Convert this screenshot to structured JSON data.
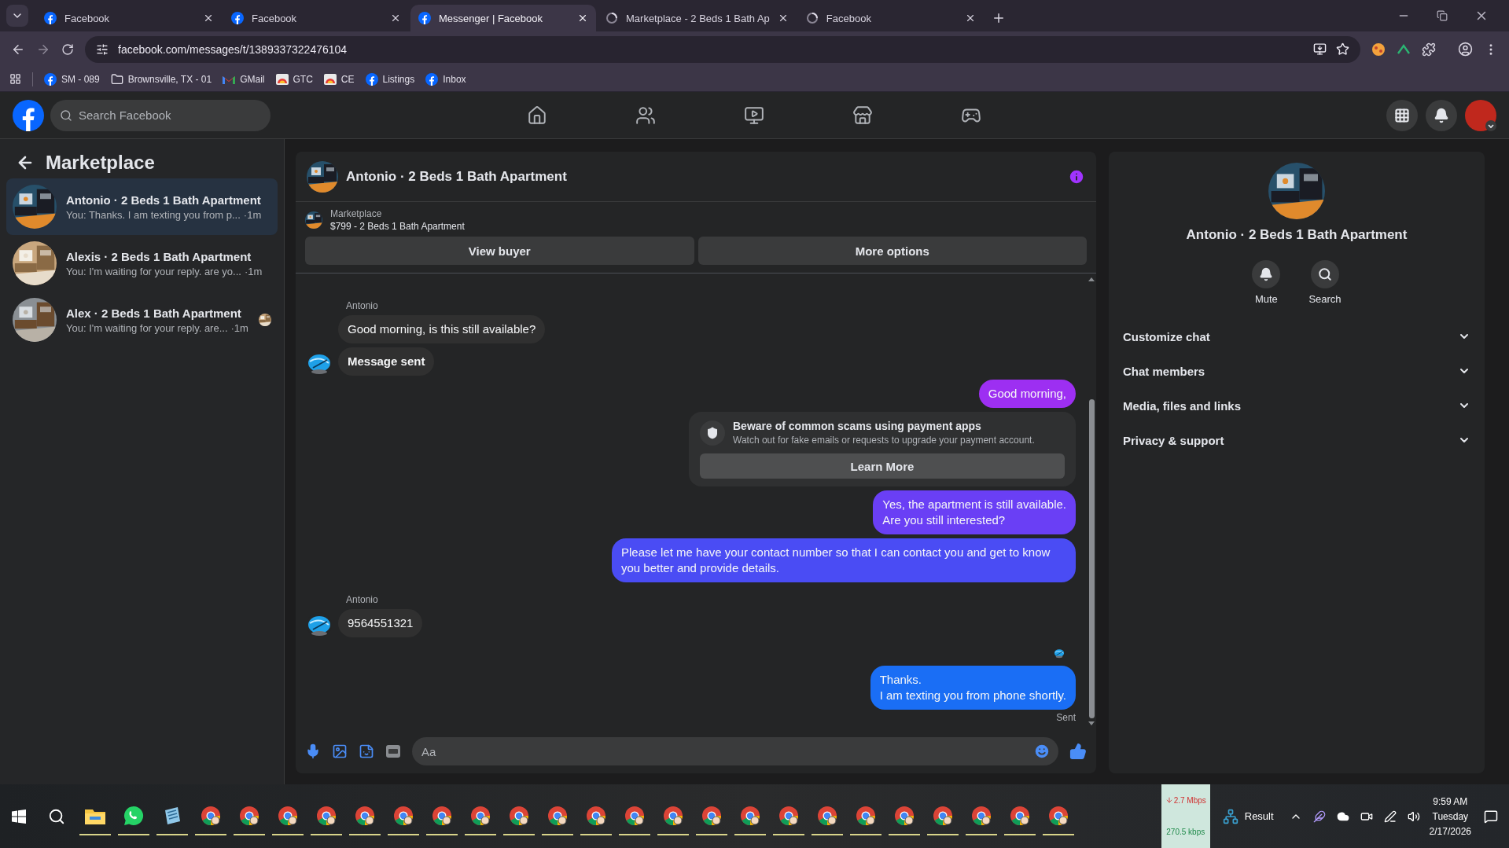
{
  "browser": {
    "tabs": [
      {
        "title": "Facebook",
        "kind": "facebook",
        "selected": false
      },
      {
        "title": "Facebook",
        "kind": "facebook",
        "selected": false
      },
      {
        "title": "Messenger | Facebook",
        "kind": "facebook",
        "selected": true
      },
      {
        "title": "Marketplace - 2 Beds 1 Bath Ap",
        "kind": "spinner",
        "selected": false
      },
      {
        "title": "Facebook",
        "kind": "spinner",
        "selected": false
      }
    ],
    "address": "facebook.com/messages/t/1389337322476104",
    "bookmarks": [
      {
        "label": "SM - 089",
        "kind": "facebook"
      },
      {
        "label": "Brownsville, TX - 01",
        "kind": "folder"
      },
      {
        "label": "GMail",
        "kind": "gmail"
      },
      {
        "label": "GTC",
        "kind": "site"
      },
      {
        "label": "CE",
        "kind": "site"
      },
      {
        "label": "Listings",
        "kind": "facebook"
      },
      {
        "label": "Inbox",
        "kind": "facebook"
      }
    ]
  },
  "header": {
    "search": {
      "placeholder": "Search Facebook"
    },
    "nav": [
      {
        "kind": "home"
      },
      {
        "kind": "friends"
      },
      {
        "kind": "video"
      },
      {
        "kind": "marketplace"
      },
      {
        "kind": "gaming"
      }
    ]
  },
  "sidebar": {
    "title": "Marketplace",
    "conversations": [
      {
        "name": "Antonio · 2 Beds 1 Bath Apartment",
        "preview": "You: Thanks. I am texting you from p...",
        "time": "·1m",
        "selected": true,
        "seen": false
      },
      {
        "name": "Alexis · 2 Beds 1 Bath Apartment",
        "preview": "You: I'm waiting for your reply. are yo...",
        "time": "·1m",
        "selected": false,
        "seen": false
      },
      {
        "name": "Alex · 2 Beds 1 Bath Apartment",
        "preview": "You: I'm waiting for your reply. are...",
        "time": "·1m",
        "selected": false,
        "seen": true
      }
    ]
  },
  "chat": {
    "title": "Antonio · 2 Beds 1 Bath Apartment",
    "listing": {
      "source": "Marketplace",
      "title": "$799 - 2 Beds 1 Bath Apartment"
    },
    "buttons": [
      "View buyer",
      "More options"
    ],
    "messages": [
      {
        "kind": "incoming",
        "sender": "Antonio",
        "text": "Good morning, is this still available?",
        "avatar": false,
        "bold": false
      },
      {
        "kind": "incoming",
        "text": "Message sent",
        "avatar": true,
        "bold": true
      },
      {
        "kind": "outgoing",
        "text": "Good morning,",
        "color": "#9d2ff2"
      },
      {
        "kind": "notice",
        "title": "Beware of common scams using payment apps",
        "text": "Watch out for fake emails or requests to upgrade your payment account.",
        "button": "Learn More"
      },
      {
        "kind": "outgoing",
        "text": "Yes, the apartment is still available.\nAre you still interested?",
        "color": "#6a3ff5"
      },
      {
        "kind": "outgoing",
        "text": "Please let me have your contact number so that I can contact you and get to know you better and provide details.",
        "color": "#4a4cf4"
      },
      {
        "kind": "incoming",
        "sender": "Antonio",
        "text": "9564551321",
        "avatar": true,
        "bold": false
      },
      {
        "kind": "seen"
      },
      {
        "kind": "outgoing",
        "text": "Thanks.\nI am texting you from phone shortly.",
        "color": "#1a6ef5"
      }
    ],
    "status": "Sent",
    "composer": {
      "placeholder": "Aa"
    }
  },
  "details": {
    "name": "Antonio · 2 Beds 1 Bath Apartment",
    "actions": [
      {
        "kind": "mute",
        "label": "Mute"
      },
      {
        "kind": "search",
        "label": "Search"
      }
    ],
    "sections": [
      {
        "label": "Customize chat",
        "expanded": false
      },
      {
        "label": "Chat members",
        "expanded": false
      },
      {
        "label": "Media, files and links",
        "expanded": false
      },
      {
        "label": "Privacy & support",
        "expanded": false
      }
    ]
  },
  "taskbar": {
    "apps": [
      {
        "kind": "folder"
      },
      {
        "kind": "whatsapp"
      },
      {
        "kind": "notes"
      },
      {
        "kind": "chrome"
      },
      {
        "kind": "chrome"
      },
      {
        "kind": "chrome"
      },
      {
        "kind": "chrome"
      },
      {
        "kind": "chrome"
      },
      {
        "kind": "chrome"
      },
      {
        "kind": "chrome"
      },
      {
        "kind": "chrome"
      },
      {
        "kind": "chrome"
      },
      {
        "kind": "chrome"
      },
      {
        "kind": "chrome"
      },
      {
        "kind": "chrome"
      },
      {
        "kind": "chrome"
      },
      {
        "kind": "chrome"
      },
      {
        "kind": "chrome"
      },
      {
        "kind": "chrome"
      },
      {
        "kind": "chrome"
      },
      {
        "kind": "chrome"
      },
      {
        "kind": "chrome"
      },
      {
        "kind": "chrome"
      },
      {
        "kind": "chrome"
      },
      {
        "kind": "chrome"
      },
      {
        "kind": "chrome"
      }
    ],
    "network": {
      "down": "2.7 Mbps",
      "up": "270.5 kbps"
    },
    "widget": "Result",
    "clock": {
      "time": "9:59 AM",
      "day": "Tuesday",
      "date": "2/17/2026"
    }
  }
}
